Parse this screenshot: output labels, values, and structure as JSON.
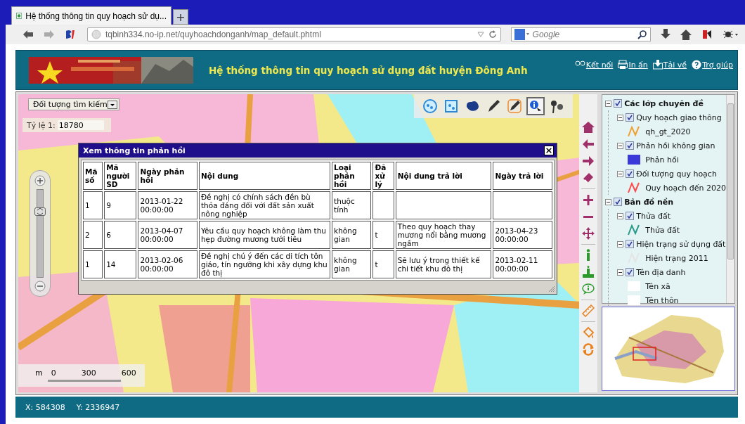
{
  "browser": {
    "tab_title": "Hệ thống thông tin quy hoạch sử dụ...",
    "new_tab": "+",
    "url": "tqbinh334.no-ip.net/quyhoachdonganh/map_default.phtml",
    "search": {
      "placeholder": "Google"
    }
  },
  "header": {
    "title": "Hệ thống thông tin quy hoạch sử dụng đất huyện Đông Anh",
    "links": [
      {
        "kind": "connect",
        "label": "Kết nối"
      },
      {
        "kind": "print",
        "label": "In ấn"
      },
      {
        "kind": "download",
        "label": "Tải về"
      },
      {
        "kind": "help",
        "label": "Trợ giúp"
      }
    ]
  },
  "map": {
    "search_dropdown": "Đối tượng tìm kiếm",
    "scale_label": "Tỷ lệ 1:",
    "scale_value": "18780",
    "tools": [
      {
        "kind": "circle",
        "selected": false
      },
      {
        "kind": "square",
        "selected": false
      },
      {
        "kind": "sql",
        "selected": false
      },
      {
        "kind": "pen",
        "selected": false
      },
      {
        "kind": "pencil",
        "selected": false
      },
      {
        "kind": "info",
        "selected": true
      },
      {
        "kind": "pin",
        "selected": false
      }
    ],
    "scale_bar": [
      "m",
      "0",
      "300",
      "600"
    ],
    "zoom_slider": {
      "level": 0.75
    }
  },
  "dialog": {
    "title": "Xem thông tin phản hồi",
    "close": "×",
    "columns": [
      "Mã số",
      "Mã người SD",
      "Ngày phản hồi",
      "Nội dung",
      "Loại phản hồi",
      "Đã xử lý",
      "Nội dung trả lời",
      "Ngày trả lời"
    ],
    "rows": [
      [
        "1",
        "9",
        "2013-01-22 00:00:00",
        "Đề nghị có chính sách đền bù thỏa đáng đối với đất sản xuất nông nghiệp",
        "thuộc tính",
        "",
        "",
        ""
      ],
      [
        "2",
        "6",
        "2013-04-07 00:00:00",
        "Yêu cầu quy hoạch không làm thu hẹp đường mương tưới tiêu",
        "không gian",
        "t",
        "Theo quy hoạch thay mương nổi bằng mương ngầm",
        "2013-04-23 00:00:00"
      ],
      [
        "1",
        "14",
        "2013-02-06 00:00:00",
        "Đề nghị chú ý đến các di tích tôn giáo, tín ngưỡng khi xây dựng khu đô thị",
        "không gian",
        "t",
        "Sẽ lưu ý trong thiết kế chi tiết khu đô thị",
        "2013-02-11 00:00:00"
      ]
    ]
  },
  "layers": [
    {
      "label": "Các lớp chuyên đề",
      "checked": true,
      "expanded": true,
      "children": [
        {
          "label": "Quy hoạch giao thông",
          "checked": true,
          "expanded": true,
          "legend": [
            {
              "label": "qh_gt_2020",
              "kind": "line",
              "color": "#f0a030"
            }
          ]
        },
        {
          "label": "Phản hồi không gian",
          "checked": true,
          "expanded": true,
          "legend": [
            {
              "label": "Phản hồi",
              "kind": "fill",
              "color": "#3a3ad8"
            }
          ]
        },
        {
          "label": "Đối tượng quy hoạch",
          "checked": true,
          "expanded": true,
          "legend": [
            {
              "label": "Quy hoạch đến 2020",
              "kind": "line",
              "color": "#ff4a4a"
            }
          ]
        }
      ]
    },
    {
      "label": "Bản đồ nền",
      "checked": true,
      "expanded": true,
      "children": [
        {
          "label": "Thửa đất",
          "checked": true,
          "expanded": true,
          "legend": [
            {
              "label": "Thửa đất",
              "kind": "line",
              "color": "#2a9a8a"
            }
          ]
        },
        {
          "label": "Hiện trạng sử dụng đất",
          "checked": true,
          "expanded": true,
          "legend": [
            {
              "label": "Hiện trạng 2011",
              "kind": "line",
              "color": "#e4e4e4"
            }
          ]
        },
        {
          "label": "Tên địa danh",
          "checked": true,
          "expanded": true,
          "legend": [
            {
              "label": "Tên xã",
              "kind": "fill",
              "color": "#ffffff"
            },
            {
              "label": "Tên thôn",
              "kind": "fill",
              "color": "#ffffff"
            }
          ]
        }
      ]
    }
  ],
  "status": {
    "x": "X: 584308",
    "y": "Y: 2336947"
  }
}
